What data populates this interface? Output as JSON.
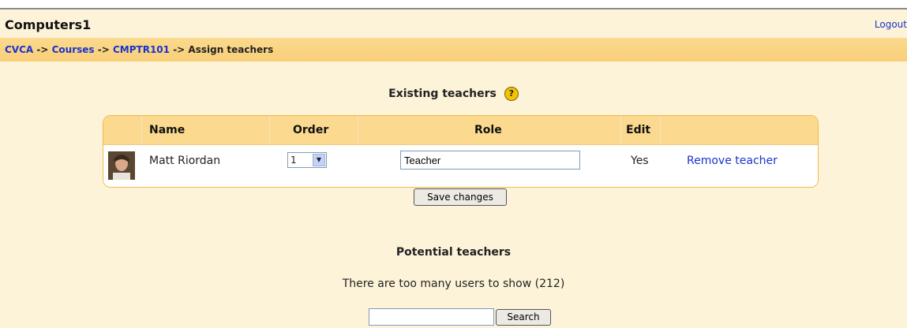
{
  "header": {
    "site_title": "Computers1",
    "logout": "Logout"
  },
  "breadcrumb": {
    "items": [
      "CVCA",
      "Courses",
      "CMPTR101"
    ],
    "current": "Assign teachers",
    "separator": "->"
  },
  "existing": {
    "title": "Existing teachers",
    "help_icon": "?",
    "columns": {
      "name": "Name",
      "order": "Order",
      "role": "Role",
      "edit": "Edit"
    },
    "row": {
      "name": "Matt Riordan",
      "order": "1",
      "role": "Teacher",
      "edit": "Yes",
      "remove": "Remove teacher"
    },
    "save_label": "Save changes"
  },
  "potential": {
    "title": "Potential teachers",
    "note": "There are too many users to show (212)",
    "search_value": "",
    "search_label": "Search"
  }
}
